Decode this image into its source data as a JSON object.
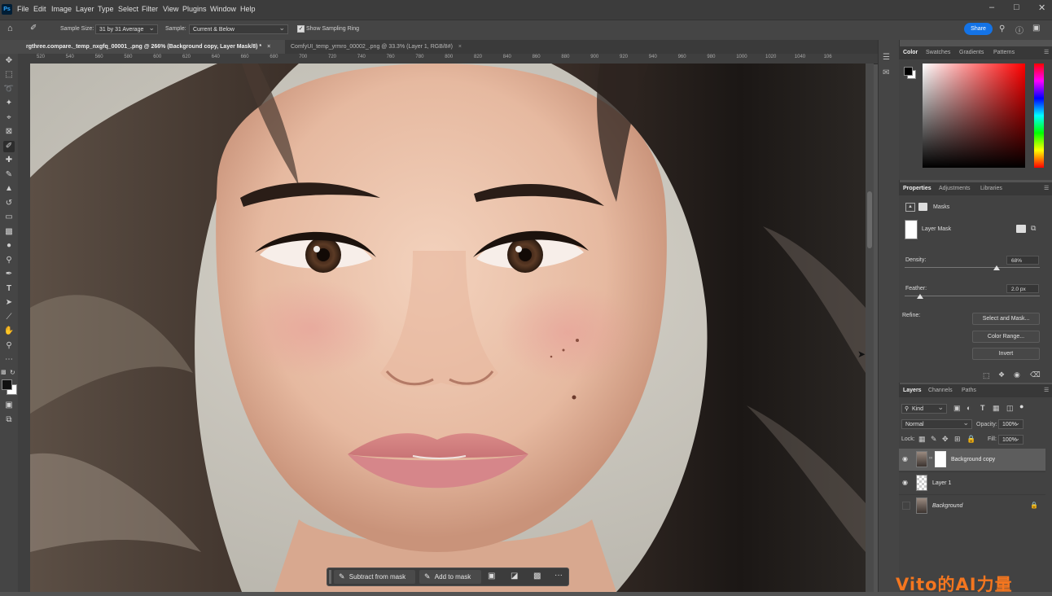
{
  "menubar": {
    "app_logo": "Ps",
    "items": [
      "File",
      "Edit",
      "Image",
      "Layer",
      "Type",
      "Select",
      "Filter",
      "View",
      "Plugins",
      "Window",
      "Help"
    ]
  },
  "options": {
    "sample_size_label": "Sample Size:",
    "sample_size_value": "31 by 31 Average",
    "sample_label": "Sample:",
    "sample_value": "Current & Below",
    "show_ring_label": "Show Sampling Ring",
    "share_label": "Share"
  },
  "tabs": [
    {
      "label": "rgthree.compare._temp_nxgfq_00001_.png @ 266% (Background copy, Layer Mask/8) *",
      "close": "×"
    },
    {
      "label": "ComfyUI_temp_yrmro_00002_.png @ 33.3% (Layer 1, RGB/8#)",
      "close": "×"
    }
  ],
  "ruler": {
    "ticks": [
      "520",
      "540",
      "560",
      "580",
      "600",
      "620",
      "640",
      "660",
      "680",
      "700",
      "720",
      "740",
      "760",
      "780",
      "800",
      "820",
      "840",
      "860",
      "880",
      "900",
      "920",
      "940",
      "960",
      "980",
      "1000",
      "1020",
      "1040",
      "106"
    ]
  },
  "color_panel": {
    "tabs": [
      "Color",
      "Swatches",
      "Gradients",
      "Patterns"
    ]
  },
  "properties_panel": {
    "tabs": [
      "Properties",
      "Adjustments",
      "Libraries"
    ],
    "masks_label": "Masks",
    "layer_mask_label": "Layer Mask",
    "density_label": "Density:",
    "density_value": "68%",
    "density_level": 0.68,
    "feather_label": "Feather:",
    "feather_value": "2.0 px",
    "refine_label": "Refine:",
    "select_and_mask": "Select and Mask...",
    "color_range": "Color Range...",
    "invert": "Invert"
  },
  "layers_panel": {
    "tabs": [
      "Layers",
      "Channels",
      "Paths"
    ],
    "filter_kind": "Kind",
    "blend_mode": "Normal",
    "opacity_label": "Opacity:",
    "opacity_value": "100%",
    "lock_label": "Lock:",
    "fill_label": "Fill:",
    "fill_value": "100%",
    "layers": [
      {
        "name": "Background copy"
      },
      {
        "name": "Layer 1"
      },
      {
        "name": "Background"
      }
    ]
  },
  "context_bar": {
    "subtract_label": "Subtract from mask",
    "add_label": "Add to mask",
    "more": "···"
  },
  "watermark": "Vito的AI力量"
}
